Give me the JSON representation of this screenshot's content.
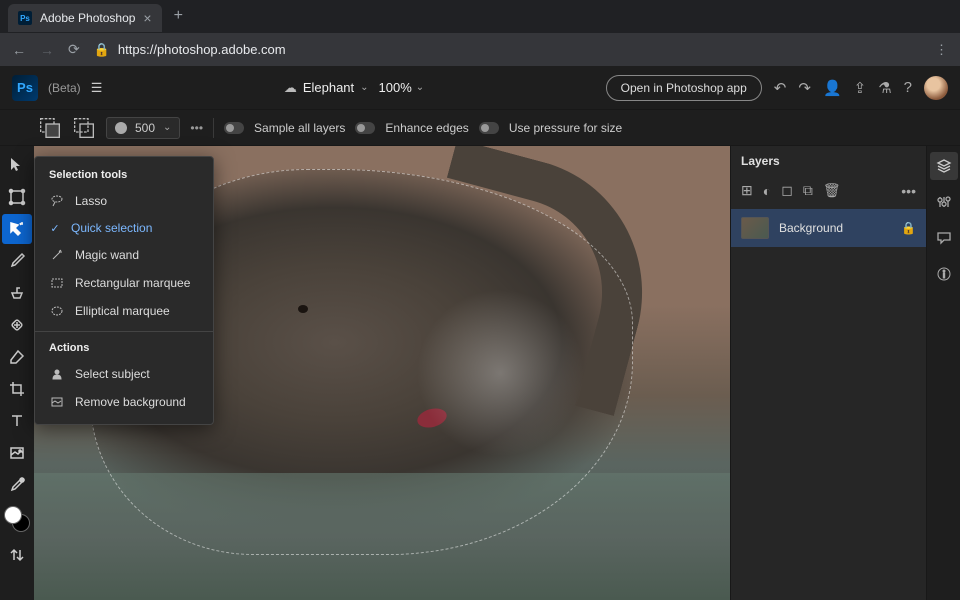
{
  "browser": {
    "tab_title": "Adobe Photoshop",
    "url": "https://photoshop.adobe.com"
  },
  "header": {
    "logo_text": "Ps",
    "beta_label": "(Beta)",
    "doc_name": "Elephant",
    "zoom": "100%",
    "open_app_label": "Open in Photoshop app"
  },
  "options": {
    "brush_size": "500",
    "sample_all": "Sample all layers",
    "enhance_edges": "Enhance edges",
    "pressure_size": "Use pressure for size"
  },
  "flyout": {
    "section_tools": "Selection tools",
    "section_actions": "Actions",
    "items": {
      "lasso": "Lasso",
      "quick_selection": "Quick selection",
      "magic_wand": "Magic wand",
      "rect_marquee": "Rectangular marquee",
      "ellip_marquee": "Elliptical marquee",
      "select_subject": "Select subject",
      "remove_bg": "Remove background"
    }
  },
  "layers": {
    "panel_title": "Layers",
    "items": [
      {
        "name": "Background"
      }
    ]
  }
}
